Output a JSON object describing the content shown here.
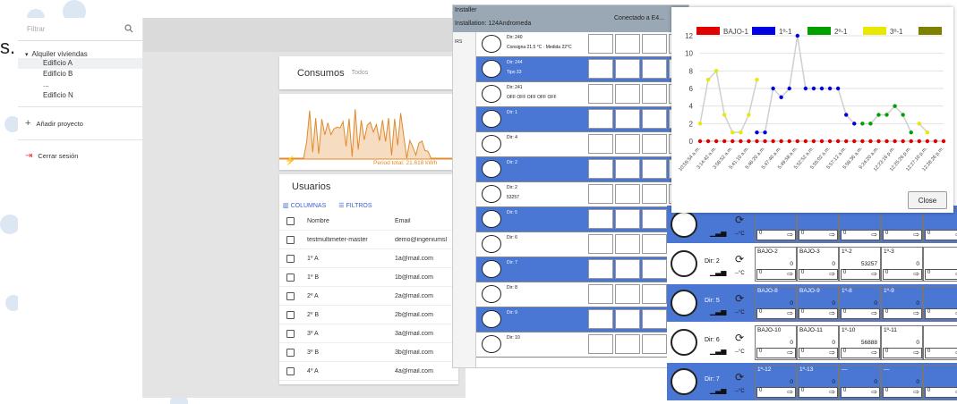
{
  "stray_text": "s.",
  "panel1": {
    "sidebar": {
      "filter_placeholder": "Filtrar",
      "group": "Alquiler viviendas",
      "items": [
        "Edificio A",
        "Edificio B",
        "...",
        "Edificio N"
      ],
      "add_project": "Añadir proyecto",
      "logout": "Cerrar sesión"
    },
    "consumos": {
      "title": "Consumos",
      "filter": "Todos",
      "period_total": "Period total: 21.618 kWh"
    },
    "users": {
      "title": "Usuarios",
      "columns_label": "COLUMNAS",
      "filters_label": "FILTROS",
      "headers": [
        "Nombre",
        "Email"
      ],
      "rows": [
        {
          "name": "testmultimeter-master",
          "email": "demo@ingeniumsl"
        },
        {
          "name": "1º A",
          "email": "1a@mail.com"
        },
        {
          "name": "1º B",
          "email": "1b@mail.com"
        },
        {
          "name": "2º A",
          "email": "2a@mail.com"
        },
        {
          "name": "2º B",
          "email": "2b@mail.com"
        },
        {
          "name": "3º A",
          "email": "3a@mail.com"
        },
        {
          "name": "3º B",
          "email": "3b@mail.com"
        },
        {
          "name": "4º A",
          "email": "4a@mail.com"
        }
      ]
    }
  },
  "panel2": {
    "title": "Installer",
    "installation": "Installation: 124Andromeda",
    "connection": "Conectado a E4...",
    "side_label": "IRS",
    "rows": [
      {
        "dir": "Dir: 240",
        "style": "white",
        "info": "Consigna 21.5 °C · Medida 22°C"
      },
      {
        "dir": "Dir: 244",
        "style": "blue",
        "info": "Tipo 33"
      },
      {
        "dir": "Dir: 241",
        "style": "white",
        "info": "OFF OFF OFF OFF OFF"
      },
      {
        "dir": "Dir: 1",
        "style": "blue",
        "info": ""
      },
      {
        "dir": "Dir: 4",
        "style": "white",
        "info": ""
      },
      {
        "dir": "Dir: 2",
        "style": "blue",
        "info": ""
      },
      {
        "dir": "Dir: 2",
        "style": "white",
        "info": "53257"
      },
      {
        "dir": "Dir: 5",
        "style": "blue",
        "info": ""
      },
      {
        "dir": "Dir: 6",
        "style": "white",
        "info": ""
      },
      {
        "dir": "Dir: 7",
        "style": "blue",
        "info": ""
      },
      {
        "dir": "Dir: 8",
        "style": "white",
        "info": ""
      },
      {
        "dir": "Dir: 9",
        "style": "blue",
        "info": ""
      },
      {
        "dir": "Dir: 10",
        "style": "white",
        "info": ""
      }
    ]
  },
  "panel3": {
    "rows": [
      {
        "dir": "",
        "style": "blue",
        "cells": [
          {
            "label": "",
            "value": ""
          },
          {
            "label": "",
            "value": ""
          },
          {
            "label": "",
            "value": ""
          },
          {
            "label": "",
            "value": ""
          },
          {
            "label": "",
            "value": ""
          }
        ]
      },
      {
        "dir": "Dir: 2",
        "style": "white",
        "cells": [
          {
            "label": "BAJO-2",
            "value": "0"
          },
          {
            "label": "BAJO-3",
            "value": "0"
          },
          {
            "label": "1º-2",
            "value": "53257"
          },
          {
            "label": "1º-3",
            "value": "0"
          },
          {
            "label": "",
            "value": ""
          }
        ]
      },
      {
        "dir": "Dir: 5",
        "style": "blue",
        "cells": [
          {
            "label": "BAJO-8",
            "value": "0"
          },
          {
            "label": "BAJO-9",
            "value": "0"
          },
          {
            "label": "1º-8",
            "value": "0"
          },
          {
            "label": "1º-9",
            "value": "0"
          },
          {
            "label": "",
            "value": ""
          }
        ]
      },
      {
        "dir": "Dir: 6",
        "style": "white",
        "cells": [
          {
            "label": "BAJO-10",
            "value": "0"
          },
          {
            "label": "BAJO-11",
            "value": "0"
          },
          {
            "label": "1º-10",
            "value": "56888"
          },
          {
            "label": "1º-11",
            "value": "0"
          },
          {
            "label": "",
            "value": ""
          }
        ]
      },
      {
        "dir": "Dir: 7",
        "style": "blue",
        "cells": [
          {
            "label": "1º-12",
            "value": "0"
          },
          {
            "label": "1º-13",
            "value": "0"
          },
          {
            "label": "—",
            "value": "0"
          },
          {
            "label": "—",
            "value": "0"
          },
          {
            "label": "",
            "value": ""
          }
        ]
      }
    ],
    "unit": "--°C"
  },
  "panel4": {
    "close_label": "Close"
  },
  "chart_data": {
    "type": "line",
    "title": "",
    "xlabel": "",
    "ylabel": "",
    "ylim": [
      0,
      12
    ],
    "yticks": [
      0,
      2,
      4,
      6,
      8,
      10,
      12
    ],
    "grid": true,
    "legend_position": "top",
    "categories": [
      "10:59:54 a.m.",
      "3:14:42 a.m.",
      "3:58:52 a.m.",
      "5:41:10 a.m.",
      "5:46:20 a.m.",
      "5:47:40 a.m.",
      "5:49:58 a.m.",
      "5:52:52 a.m.",
      "5:55:02 a.m.",
      "5:57:12 a.m.",
      "5:58:36 a.m.",
      "9:24:20 a.m.",
      "12:23:16 p.m.",
      "12:25:26 p.m.",
      "12:27:10 p.m.",
      "12:28:26 p.m."
    ],
    "x_count": 31,
    "series": [
      {
        "name": "BAJO-1",
        "color": "#e00000",
        "values": [
          0,
          0,
          0,
          0,
          0,
          0,
          0,
          0,
          0,
          0,
          0,
          0,
          0,
          0,
          0,
          0,
          0,
          0,
          0,
          0,
          0,
          0,
          0,
          0,
          0,
          0,
          0,
          0,
          0,
          0,
          0
        ]
      },
      {
        "name": "1º-1",
        "color": "#0000e0",
        "values": [
          null,
          null,
          null,
          null,
          null,
          null,
          null,
          1,
          1,
          6,
          5,
          6,
          12,
          6,
          6,
          6,
          6,
          6,
          3,
          2,
          null,
          null,
          null,
          null,
          null,
          null,
          null,
          null,
          null,
          null,
          null
        ]
      },
      {
        "name": "2º-1",
        "color": "#00a000",
        "values": [
          null,
          null,
          null,
          null,
          null,
          null,
          null,
          null,
          null,
          null,
          null,
          null,
          null,
          null,
          null,
          null,
          null,
          null,
          null,
          null,
          2,
          2,
          3,
          3,
          4,
          3,
          1,
          null,
          null,
          null,
          null
        ]
      },
      {
        "name": "3º-1",
        "color": "#e8e800",
        "values": [
          2,
          7,
          8,
          3,
          1,
          1,
          3,
          7,
          null,
          null,
          null,
          null,
          null,
          null,
          null,
          null,
          null,
          null,
          null,
          null,
          null,
          null,
          null,
          null,
          null,
          null,
          null,
          2,
          1,
          null,
          null
        ]
      },
      {
        "name": "",
        "color": "#808000",
        "values": []
      }
    ]
  }
}
